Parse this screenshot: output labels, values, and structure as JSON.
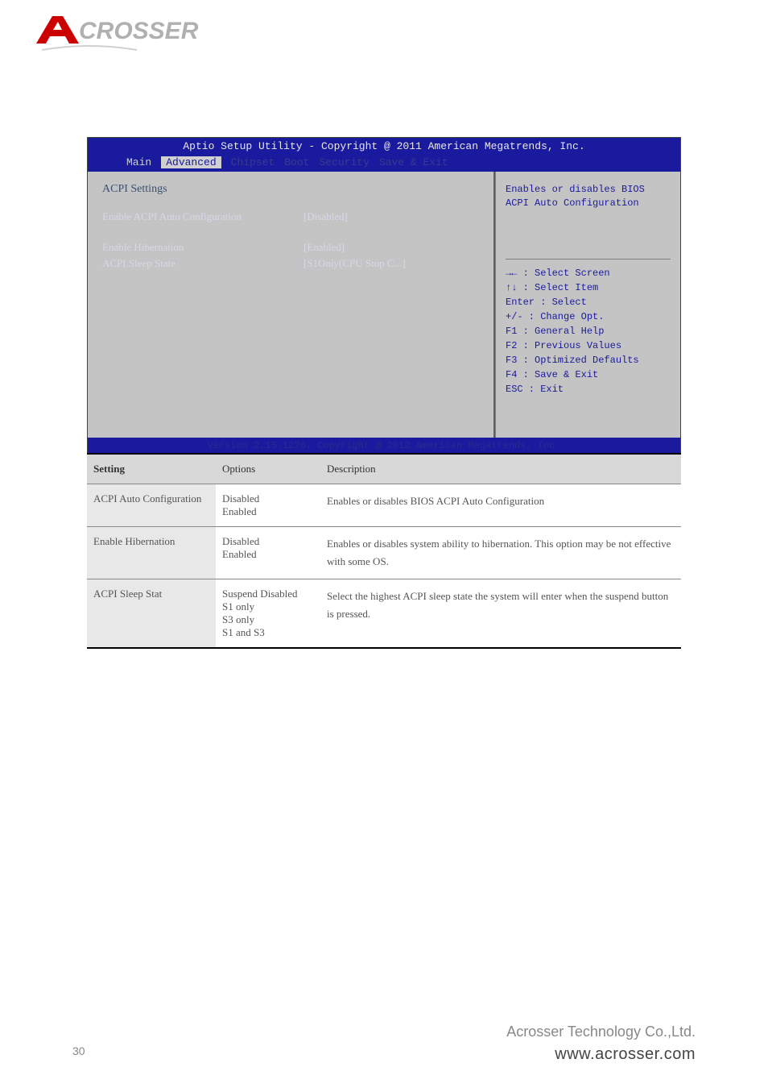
{
  "logo": {
    "name": "ACROSSER"
  },
  "bios": {
    "title": "Aptio Setup Utility - Copyright @ 2011 American Megatrends, Inc.",
    "tabs": {
      "main": "Main",
      "advanced": "Advanced",
      "chipset": "Chipset",
      "boot": "Boot",
      "security": "Security",
      "save_exit": "Save & Exit"
    },
    "section_title": "ACPI Settings",
    "settings": [
      {
        "label": "Enable ACPI Auto Configuration",
        "value": "[Disabled]"
      },
      {
        "label": "Enable Hibernation",
        "value": "[Enabled]"
      },
      {
        "label": "ACPI Sleep State",
        "value": "[S1Only(CPU Stop C...]"
      }
    ],
    "help_text": "Enables or disables BIOS ACPI Auto Configuration",
    "keys": [
      "→← : Select Screen",
      "↑↓ : Select Item",
      "Enter : Select",
      "+/- : Change Opt.",
      "F1 : General Help",
      "F2 : Previous Values",
      "F3 : Optimized Defaults",
      "F4 : Save & Exit",
      "ESC : Exit"
    ],
    "footer": "Version 2.15.1226. Copyright @ 2012 American Megatrends, Inc."
  },
  "table": {
    "headers": {
      "setting": "Setting",
      "options": "Options",
      "description": "Description"
    },
    "rows": [
      {
        "setting": "ACPI Auto Configuration",
        "options": "Disabled\nEnabled",
        "description": "Enables or disables BIOS ACPI Auto Configuration"
      },
      {
        "setting": "Enable Hibernation",
        "options": "Disabled\nEnabled",
        "description": "Enables or disables system ability to hibernation. This option may be not effective with some OS."
      },
      {
        "setting": "ACPI Sleep Stat",
        "options": "Suspend Disabled\nS1 only\nS3 only\nS1 and S3",
        "description": "Select the highest ACPI sleep state the system will enter when the suspend button is pressed."
      }
    ]
  },
  "footer": {
    "company": "Acrosser Technology Co.,Ltd.",
    "url": "www.acrosser.com",
    "page": "30"
  }
}
